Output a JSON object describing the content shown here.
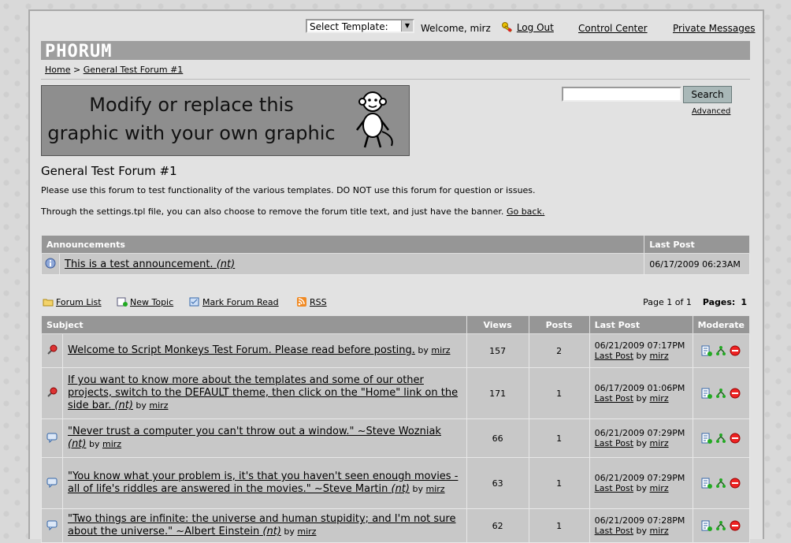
{
  "header": {
    "template_select": "Select Template:",
    "welcome": "Welcome, mirz",
    "logout": "Log Out",
    "control_center": "Control Center",
    "private_messages": "Private Messages",
    "logo": "PHORUM"
  },
  "breadcrumb": {
    "home": "Home",
    "sep": ">",
    "forum": "General Test Forum #1"
  },
  "banner": {
    "line1": "Modify or replace this",
    "line2": "graphic with your own graphic"
  },
  "search": {
    "button": "Search",
    "advanced": "Advanced",
    "value": ""
  },
  "forum": {
    "title": "General Test Forum #1",
    "desc1": "Please use this forum to test functionality of the various templates. DO NOT use this forum for question or issues.",
    "desc2": "Through the settings.tpl file, you can also choose to remove the forum title text, and just have the banner.",
    "go_back": "Go back."
  },
  "announcements": {
    "col_subject": "Announcements",
    "col_last": "Last Post",
    "rows": [
      {
        "title": "This is a test announcement.",
        "nt": "(nt)",
        "date": "06/17/2009 06:23AM"
      }
    ]
  },
  "toolbar": {
    "forum_list": "Forum List",
    "new_topic": "New Topic",
    "mark_read": "Mark Forum Read",
    "rss": "RSS",
    "page_of": "Page 1 of 1",
    "pages_label": "Pages:",
    "pages_value": "1"
  },
  "topics": {
    "headers": {
      "subject": "Subject",
      "views": "Views",
      "posts": "Posts",
      "last": "Last Post",
      "moderate": "Moderate"
    },
    "rows": [
      {
        "title": "Welcome to Script Monkeys Test Forum. Please read before posting.",
        "nt": "",
        "by": "by",
        "author": "mirz",
        "views": "157",
        "posts": "2",
        "date": "06/21/2009 07:17PM",
        "lastpost": "Last Post",
        "lastby": "by",
        "lastauthor": "mirz",
        "icon": "sticky-pin-icon"
      },
      {
        "title": "If you want to know more about the templates and some of our other projects, switch to the DEFAULT theme, then click on the \"Home\" link on the side bar.",
        "nt": "(nt)",
        "by": "by",
        "author": "mirz",
        "views": "171",
        "posts": "1",
        "date": "06/17/2009 01:06PM",
        "lastpost": "Last Post",
        "lastby": "by",
        "lastauthor": "mirz",
        "icon": "sticky-pin-icon"
      },
      {
        "title": "\"Never trust a computer you can't throw out a window.\" ~Steve Wozniak",
        "nt": "(nt)",
        "by": "by",
        "author": "mirz",
        "views": "66",
        "posts": "1",
        "date": "06/21/2009 07:29PM",
        "lastpost": "Last Post",
        "lastby": "by",
        "lastauthor": "mirz",
        "icon": "message-icon"
      },
      {
        "title": "\"You know what your problem is, it's that you haven't seen enough movies - all of life's riddles are answered in the movies.\" ~Steve Martin",
        "nt": "(nt)",
        "by": "by",
        "author": "mirz",
        "views": "63",
        "posts": "1",
        "date": "06/21/2009 07:29PM",
        "lastpost": "Last Post",
        "lastby": "by",
        "lastauthor": "mirz",
        "icon": "message-icon"
      },
      {
        "title": "\"Two things are infinite: the universe and human stupidity; and I'm not sure about the universe.\" ~Albert Einstein",
        "nt": "(nt)",
        "by": "by",
        "author": "mirz",
        "views": "62",
        "posts": "1",
        "date": "06/21/2009 07:28PM",
        "lastpost": "Last Post",
        "lastby": "by",
        "lastauthor": "mirz",
        "icon": "message-icon"
      }
    ]
  }
}
